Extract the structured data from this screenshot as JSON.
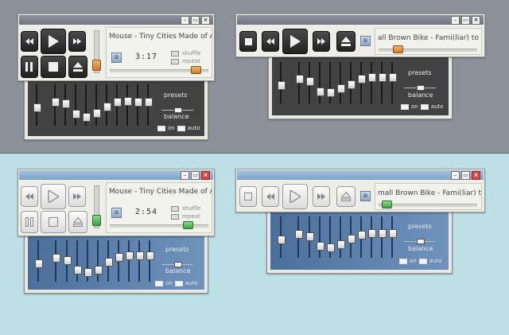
{
  "players": [
    {
      "id": "top-left",
      "theme": "dark",
      "track_text": "Mouse - Tiny Cities Made of A",
      "time": "3:17",
      "shuffle_label": "shuffle",
      "repeat_label": "repeat",
      "app_icon": "windows-flag-icon",
      "eq_presets_label": "presets",
      "eq_balance_label": "balance",
      "eq_on_label": "on",
      "eq_auto_label": "auto",
      "window_buttons": [
        "minimize",
        "maximize",
        "close"
      ]
    },
    {
      "id": "top-right",
      "theme": "dark",
      "track_text": "all Brown Bike - Fami(liar) to You",
      "app_icon": "windows-flag-icon",
      "eq_presets_label": "presets",
      "eq_balance_label": "balance",
      "eq_on_label": "on",
      "eq_auto_label": "auto",
      "window_buttons": [
        "minimize",
        "maximize",
        "close"
      ]
    },
    {
      "id": "bottom-left",
      "theme": "light",
      "track_text": "Mouse - Tiny Cities Made of A",
      "time": "2:54",
      "shuffle_label": "shuffle",
      "repeat_label": "repeat",
      "app_icon": "windows-flag-icon",
      "eq_presets_label": "presets",
      "eq_balance_label": "balance",
      "eq_on_label": "on",
      "eq_auto_label": "auto",
      "window_buttons": [
        "minimize",
        "maximize",
        "close"
      ]
    },
    {
      "id": "bottom-right",
      "theme": "light",
      "track_text": "mall Brown Bike - Fami(liar) to Y",
      "app_icon": "windows-flag-icon",
      "eq_presets_label": "presets",
      "eq_balance_label": "balance",
      "eq_on_label": "on",
      "eq_auto_label": "auto",
      "window_buttons": [
        "minimize",
        "maximize",
        "close"
      ]
    }
  ],
  "colors": {
    "top_background": "#8c929a",
    "bottom_background": "#bde0e6",
    "dark_accent": "#d07b2a",
    "light_accent": "#3fa33f",
    "light_close": "#d94848"
  },
  "eq_band_levels_top_left": [
    0.3,
    0.4,
    0.4,
    0.5,
    0.45,
    0.5,
    0.4,
    0.3,
    0.3,
    0.3,
    0.3
  ],
  "eq_band_levels_top_right": [
    0.5,
    0.3,
    0.3,
    0.45,
    0.45,
    0.4,
    0.3,
    0.3,
    0.3,
    0.3,
    0.3
  ]
}
